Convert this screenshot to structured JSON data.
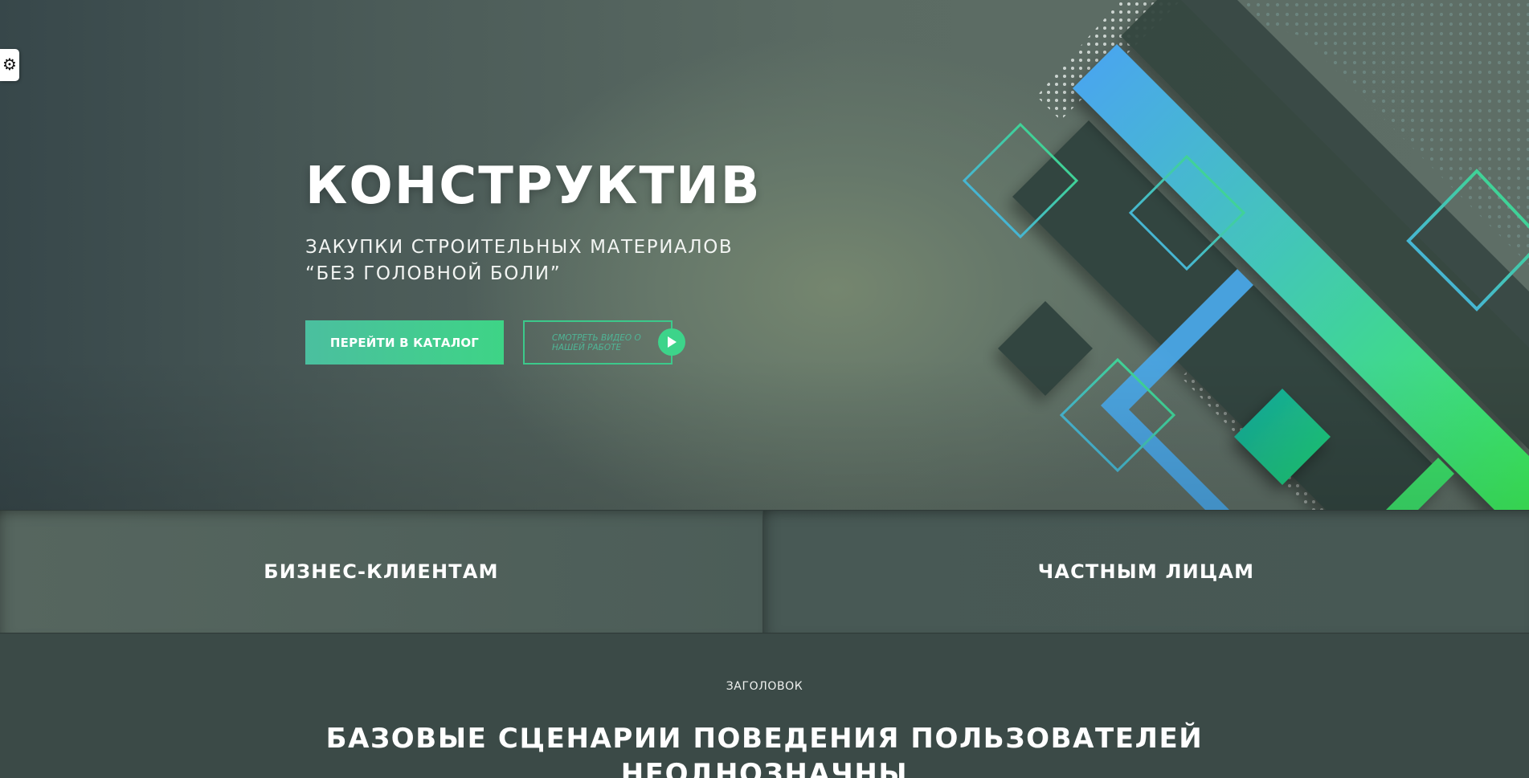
{
  "settings": {
    "icon": "gear-icon",
    "glyph": "⚙"
  },
  "hero": {
    "title": "КОНСТРУКТИВ",
    "subtitle_line1": "ЗАКУПКИ СТРОИТЕЛЬНЫХ МАТЕРИАЛОВ",
    "subtitle_line2": "“БЕЗ ГОЛОВНОЙ БОЛИ”",
    "catalog_button": "ПЕРЕЙТИ В КАТАЛОГ",
    "video_button": "СМОТРЕТЬ ВИДЕО О НАШЕЙ РАБОТЕ",
    "play_icon": "play-icon"
  },
  "audience": {
    "business": "БИЗНЕС-КЛИЕНТАМ",
    "private": "ЧАСТНЫМ ЛИЦАМ"
  },
  "section": {
    "eyebrow": "ЗАГОЛОВОК",
    "title": "БАЗОВЫЕ СЦЕНАРИИ ПОВЕДЕНИЯ ПОЛЬЗОВАТЕЛЕЙ",
    "title_line2": "НЕОДНОЗНАЧНЫ"
  },
  "colors": {
    "accent_green": "#3ed486",
    "accent_teal": "#4bbf9f",
    "accent_blue": "#4aa8f0",
    "dark_panel": "#33443f"
  }
}
